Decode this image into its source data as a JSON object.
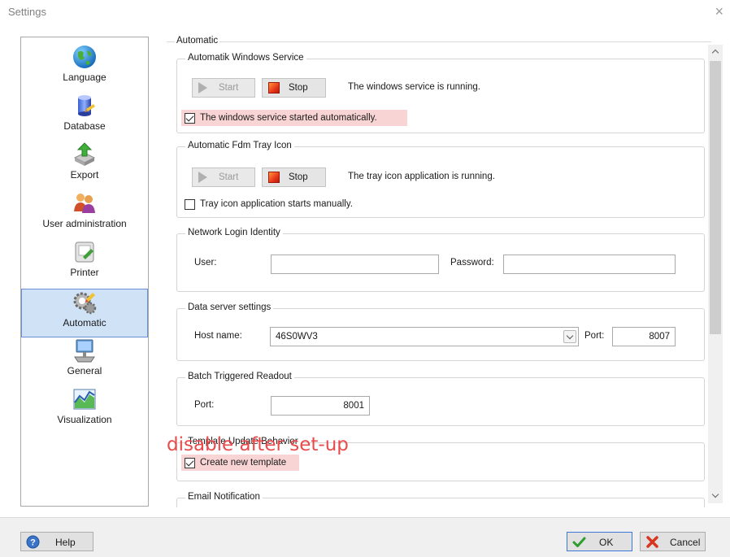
{
  "window": {
    "title": "Settings",
    "close_glyph": "×"
  },
  "nav": {
    "items": [
      {
        "label": "Language",
        "icon": "globe-icon"
      },
      {
        "label": "Database",
        "icon": "database-icon"
      },
      {
        "label": "Export",
        "icon": "export-icon"
      },
      {
        "label": "User administration",
        "icon": "users-icon"
      },
      {
        "label": "Printer",
        "icon": "printer-icon"
      },
      {
        "label": "Automatic",
        "icon": "gears-icon",
        "selected": true
      },
      {
        "label": "General",
        "icon": "computer-icon"
      },
      {
        "label": "Visualization",
        "icon": "chart-icon"
      }
    ]
  },
  "content": {
    "section_title": "Automatic",
    "windows_service": {
      "title": "Automatik Windows Service",
      "start_label": "Start",
      "stop_label": "Stop",
      "status": "The windows service is running.",
      "auto_start_label": "The windows service started automatically.",
      "auto_start_checked": true
    },
    "tray_icon": {
      "title": "Automatic Fdm Tray Icon",
      "start_label": "Start",
      "stop_label": "Stop",
      "status": "The tray icon application is running.",
      "manual_label": "Tray icon application starts manually.",
      "manual_checked": false
    },
    "network_login": {
      "title": "Network Login Identity",
      "user_label": "User:",
      "user_value": "",
      "password_label": "Password:",
      "password_value": ""
    },
    "data_server": {
      "title": "Data server settings",
      "host_label": "Host name:",
      "host_value": "46S0WV3",
      "port_label": "Port:",
      "port_value": "8007"
    },
    "batch_readout": {
      "title": "Batch Triggered Readout",
      "port_label": "Port:",
      "port_value": "8001"
    },
    "template_update": {
      "title": "Template Update Behavior",
      "create_label": "Create new template",
      "create_checked": true
    },
    "email_notification": {
      "title": "Email Notification"
    }
  },
  "annotation": {
    "text": "disable after set-up",
    "color": "#e84b4b"
  },
  "footer": {
    "help_label": "Help",
    "ok_label": "OK",
    "cancel_label": "Cancel"
  },
  "colors": {
    "selected_nav_bg": "#cfe2f6",
    "highlight": "#f9d4d4",
    "focus_border": "#3b78d8"
  }
}
